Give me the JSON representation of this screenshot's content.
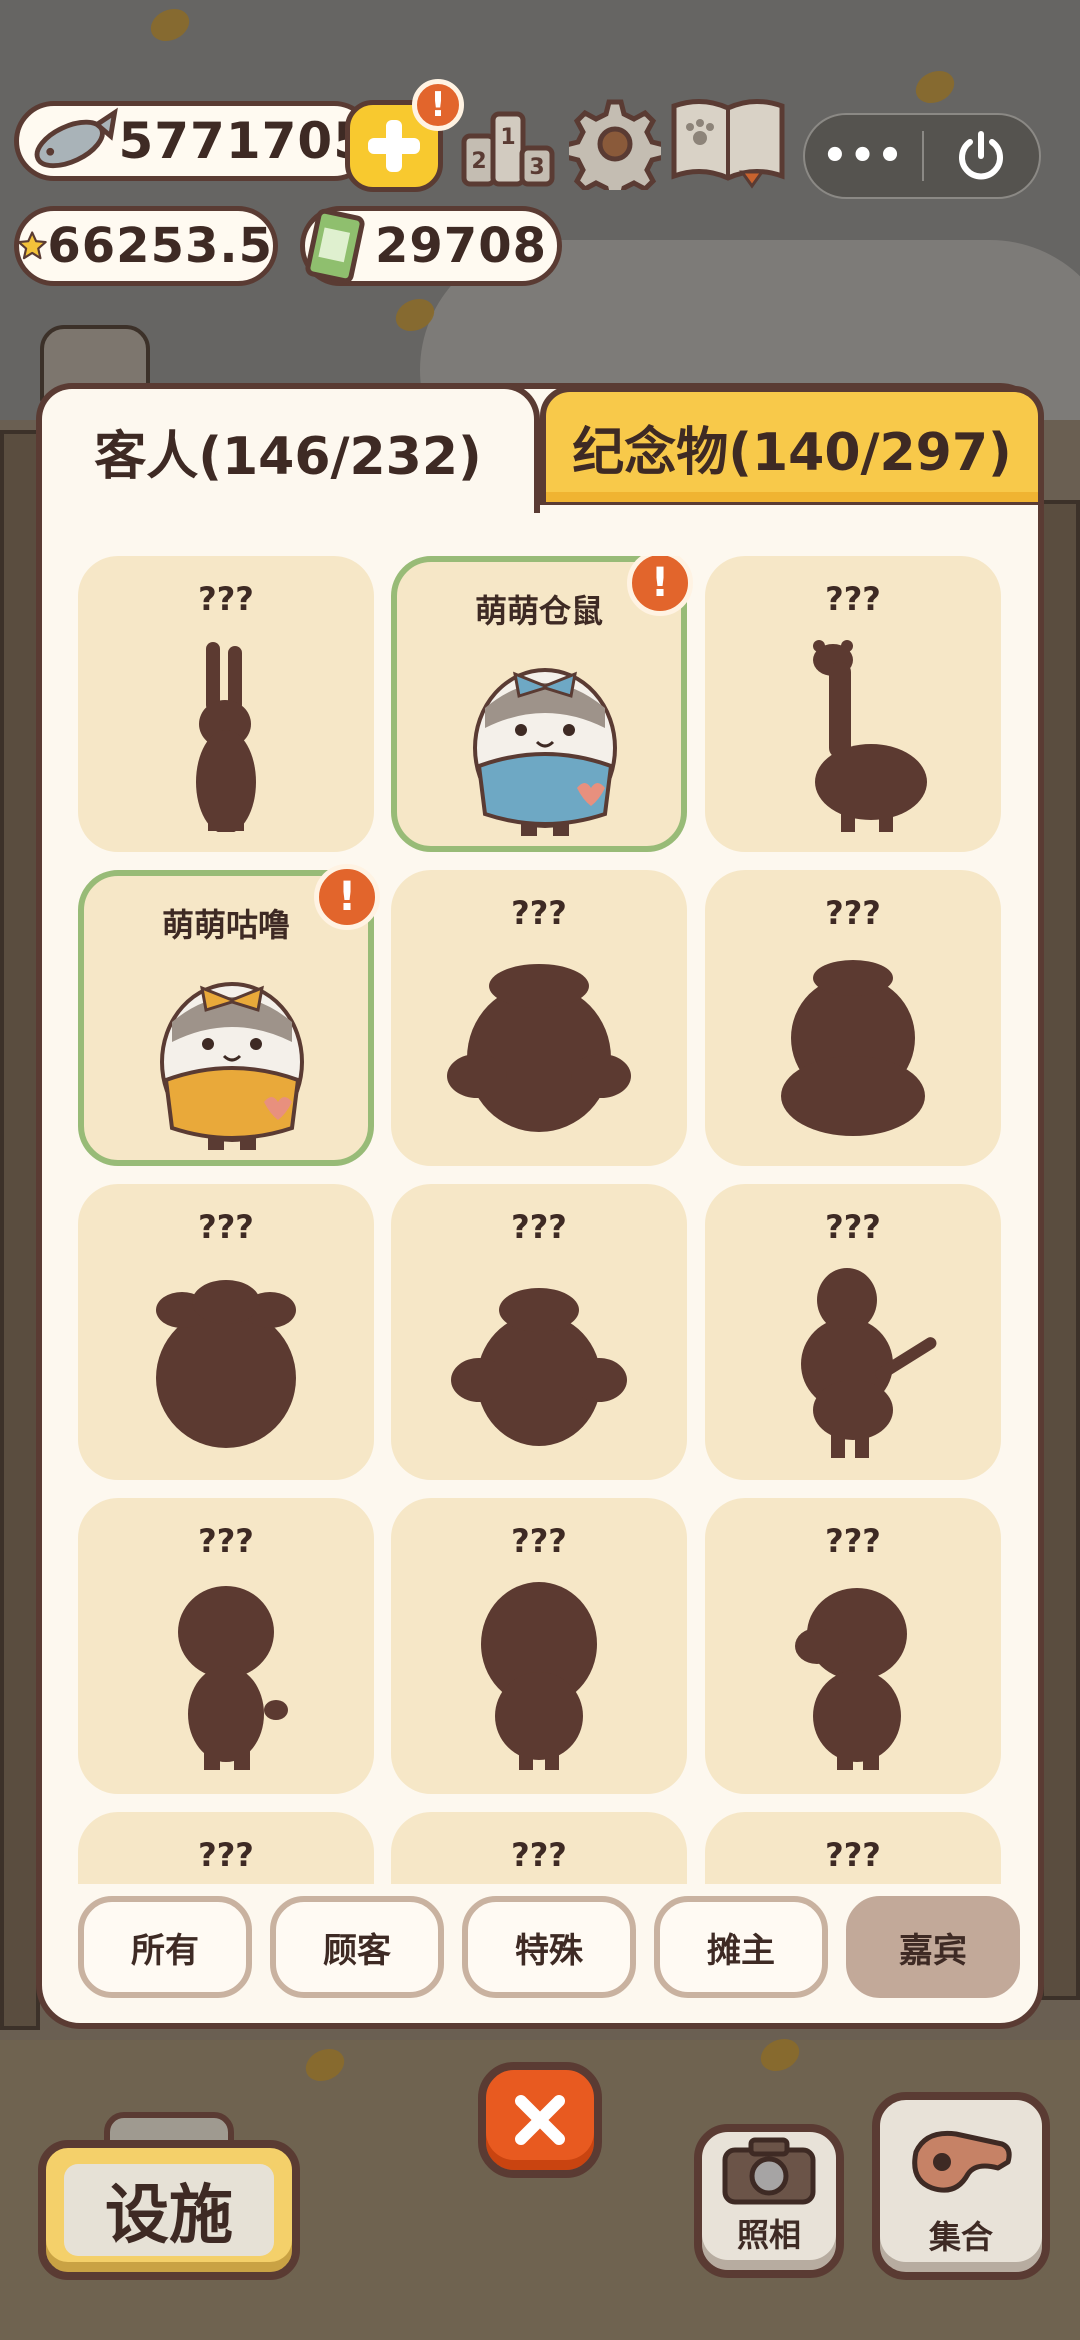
{
  "hud": {
    "fish": "5771705",
    "stars": "66253.5",
    "tickets": "29708",
    "alert_mark": "!",
    "more_label": "•••"
  },
  "tabs": {
    "guests": "客人(146/232)",
    "souvenirs": "纪念物(140/297)"
  },
  "cards": [
    {
      "name": "???",
      "discovered": false,
      "shape": "rabbit"
    },
    {
      "name": "萌萌仓鼠",
      "discovered": true,
      "shape": "hamster",
      "alert": "!"
    },
    {
      "name": "???",
      "discovered": false,
      "shape": "alpaca"
    },
    {
      "name": "萌萌咕噜",
      "discovered": true,
      "shape": "hamster2",
      "alert": "!"
    },
    {
      "name": "???",
      "discovered": false,
      "shape": "blob"
    },
    {
      "name": "???",
      "discovered": false,
      "shape": "chick"
    },
    {
      "name": "???",
      "discovered": false,
      "shape": "blob2"
    },
    {
      "name": "???",
      "discovered": false,
      "shape": "blob3"
    },
    {
      "name": "???",
      "discovered": false,
      "shape": "guitar"
    },
    {
      "name": "???",
      "discovered": false,
      "shape": "kid"
    },
    {
      "name": "???",
      "discovered": false,
      "shape": "girl"
    },
    {
      "name": "???",
      "discovered": false,
      "shape": "boy"
    },
    {
      "name": "???",
      "discovered": false,
      "shape": "blob"
    },
    {
      "name": "???",
      "discovered": false,
      "shape": "blob"
    },
    {
      "name": "???",
      "discovered": false,
      "shape": "blob"
    }
  ],
  "filters": [
    {
      "label": "所有",
      "active": false
    },
    {
      "label": "顾客",
      "active": false
    },
    {
      "label": "特殊",
      "active": false
    },
    {
      "label": "摊主",
      "active": false
    },
    {
      "label": "嘉宾",
      "active": true
    }
  ],
  "bottom": {
    "facility": "设施",
    "photo": "照相",
    "gather": "集合"
  },
  "colors": {
    "accent_orange": "#e2652c",
    "tab_yellow": "#f8c94a",
    "card_bg": "#f6e7c7",
    "discovered_border": "#98bb77",
    "silhouette": "#5c3a31",
    "active_filter": "#c2a999"
  }
}
